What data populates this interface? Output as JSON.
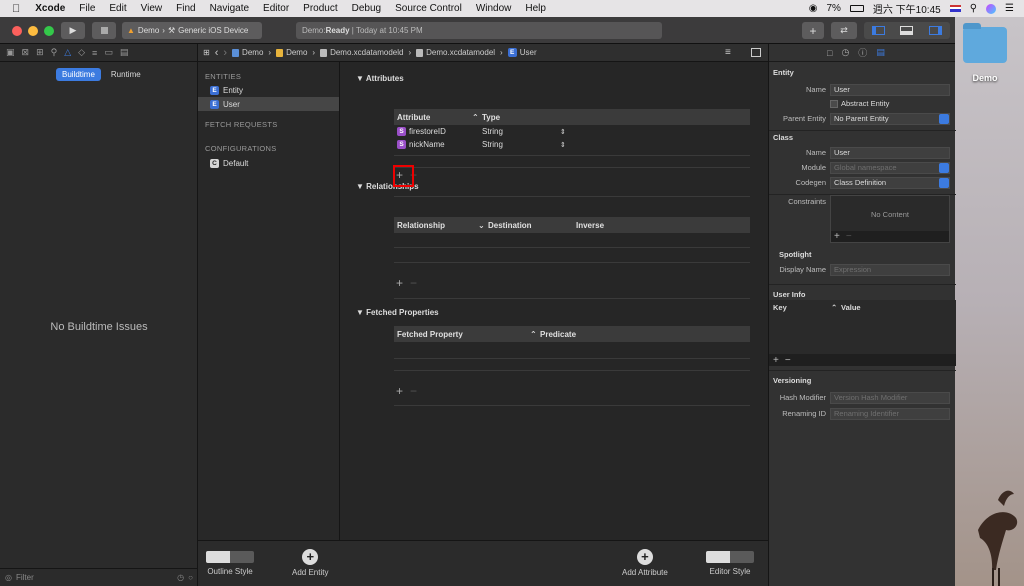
{
  "menubar": {
    "items": [
      "Xcode",
      "File",
      "Edit",
      "View",
      "Find",
      "Navigate",
      "Editor",
      "Product",
      "Debug",
      "Source Control",
      "Window",
      "Help"
    ],
    "battery": "7%",
    "clock": "週六 下午10:45"
  },
  "toolbar": {
    "scheme_app": "Demo",
    "scheme_device": "Generic iOS Device",
    "status_prefix": "Demo: ",
    "status_state": "Ready",
    "status_time": " | Today at 10:45 PM"
  },
  "navigator": {
    "tab_buildtime": "Buildtime",
    "tab_runtime": "Runtime",
    "empty_message": "No Buildtime Issues",
    "filter_placeholder": "Filter"
  },
  "jumpbar": {
    "crumbs": [
      "Demo",
      "Demo",
      "Demo.xcdatamodeld",
      "Demo.xcdatamodel",
      "User"
    ]
  },
  "entities_panel": {
    "entities_header": "ENTITIES",
    "entities": [
      "Entity",
      "User"
    ],
    "fetch_header": "FETCH REQUESTS",
    "config_header": "CONFIGURATIONS",
    "configurations": [
      "Default"
    ],
    "badge_entity": "E",
    "badge_config": "C"
  },
  "editor": {
    "attributes": {
      "title": "Attributes",
      "col_attribute": "Attribute",
      "col_type": "Type",
      "badge": "S",
      "rows": [
        {
          "name": "firestoreID",
          "type": "String"
        },
        {
          "name": "nickName",
          "type": "String"
        }
      ]
    },
    "relationships": {
      "title": "Relationships",
      "col_relationship": "Relationship",
      "col_destination": "Destination",
      "col_inverse": "Inverse"
    },
    "fetched": {
      "title": "Fetched Properties",
      "col_property": "Fetched Property",
      "col_predicate": "Predicate"
    },
    "add_symbol": "+",
    "remove_symbol": "−"
  },
  "bottombar": {
    "outline_style": "Outline Style",
    "add_entity": "Add Entity",
    "add_attribute": "Add Attribute",
    "editor_style": "Editor Style"
  },
  "inspector": {
    "entity_header": "Entity",
    "name_label": "Name",
    "name_value": "User",
    "abstract_label": "Abstract Entity",
    "parent_label": "Parent Entity",
    "parent_value": "No Parent Entity",
    "class_header": "Class",
    "class_name_label": "Name",
    "class_name_value": "User",
    "module_label": "Module",
    "module_placeholder": "Global namespace",
    "codegen_label": "Codegen",
    "codegen_value": "Class Definition",
    "constraints_label": "Constraints",
    "constraints_empty": "No Content",
    "spotlight_header": "Spotlight",
    "display_name_label": "Display Name",
    "display_name_placeholder": "Expression",
    "userinfo_header": "User Info",
    "col_key": "Key",
    "col_value": "Value",
    "versioning_header": "Versioning",
    "hash_label": "Hash Modifier",
    "hash_placeholder": "Version Hash Modifier",
    "renaming_label": "Renaming ID",
    "renaming_placeholder": "Renaming Identifier"
  },
  "desktop": {
    "folder_label": "Demo"
  },
  "colors": {
    "accent": "#3c7be0",
    "highlight": "#e00000",
    "string_badge": "#9a4fc8"
  }
}
